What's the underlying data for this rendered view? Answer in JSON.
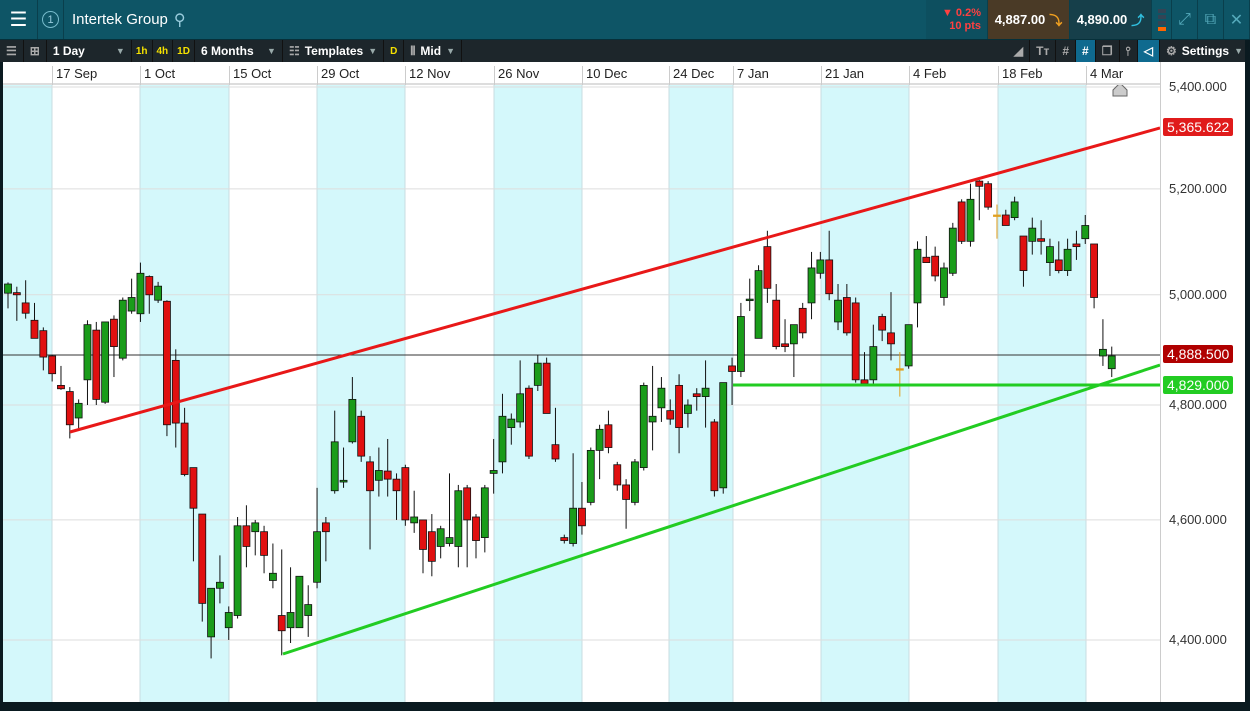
{
  "header": {
    "title": "Intertek Group",
    "badge": "1",
    "change_pct": "▼ 0.2%",
    "change_pts": "10 pts",
    "sell": "4,887.00",
    "buy": "4,890.00"
  },
  "toolbar": {
    "interval": "1 Day",
    "quick": [
      "1h",
      "4h",
      "1D"
    ],
    "range": "6 Months",
    "templates": "Templates",
    "d": "D",
    "price_type": "Mid",
    "settings": "Settings"
  },
  "dates": [
    "17 Sep",
    "1 Oct",
    "15 Oct",
    "29 Oct",
    "12 Nov",
    "26 Nov",
    "10 Dec",
    "24 Dec",
    "7 Jan",
    "21 Jan",
    "4 Feb",
    "18 Feb",
    "4 Mar"
  ],
  "price_axis": [
    "5,400.000",
    "5,200.000",
    "5,000.000",
    "4,800.000",
    "4,600.000",
    "4,400.000"
  ],
  "tags": {
    "upper_trend": "5,365.622",
    "current": "4,888.500",
    "support": "4,829.000"
  },
  "colors": {
    "up": "#1a9c1a",
    "down": "#e01010",
    "band": "#d4f8fb",
    "trend_up": "#e81818",
    "trend_low": "#22cc22"
  },
  "chart_data": {
    "type": "candlestick",
    "ylim": [
      4350,
      5420
    ],
    "ohlc": [
      [
        5003,
        5023,
        4975,
        5020
      ],
      [
        5004,
        5015,
        4952,
        5000
      ],
      [
        4985,
        5027,
        4956,
        4966
      ],
      [
        4953,
        4985,
        4920,
        4920
      ],
      [
        4934,
        4940,
        4862,
        4886
      ],
      [
        4888,
        4890,
        4842,
        4856
      ],
      [
        4835,
        4870,
        4827,
        4829
      ],
      [
        4824,
        4832,
        4741,
        4765
      ],
      [
        4777,
        4810,
        4755,
        4803
      ],
      [
        4845,
        4953,
        4800,
        4945
      ],
      [
        4935,
        4950,
        4800,
        4810
      ],
      [
        4805,
        4950,
        4802,
        4950
      ],
      [
        4955,
        4962,
        4850,
        4905
      ],
      [
        4884,
        4995,
        4880,
        4990
      ],
      [
        4970,
        5030,
        4965,
        4995
      ],
      [
        4965,
        5060,
        4950,
        5040
      ],
      [
        5034,
        5036,
        4965,
        5000
      ],
      [
        4990,
        5024,
        4985,
        5016
      ],
      [
        4988,
        4990,
        4745,
        4765
      ],
      [
        4880,
        4900,
        4725,
        4768
      ],
      [
        4768,
        4795,
        4675,
        4678
      ],
      [
        4690,
        4690,
        4530,
        4620
      ],
      [
        4610,
        4610,
        4430,
        4460
      ],
      [
        4405,
        4485,
        4370,
        4485
      ],
      [
        4485,
        4540,
        4460,
        4495
      ],
      [
        4420,
        4455,
        4400,
        4445
      ],
      [
        4440,
        4605,
        4435,
        4590
      ],
      [
        4590,
        4625,
        4520,
        4555
      ],
      [
        4580,
        4600,
        4540,
        4595
      ],
      [
        4580,
        4590,
        4510,
        4540
      ],
      [
        4498,
        4560,
        4485,
        4510
      ],
      [
        4440,
        4550,
        4375,
        4415
      ],
      [
        4420,
        4520,
        4395,
        4445
      ],
      [
        4420,
        4505,
        4420,
        4505
      ],
      [
        4440,
        4490,
        4405,
        4458
      ],
      [
        4495,
        4655,
        4485,
        4580
      ],
      [
        4595,
        4605,
        4530,
        4580
      ],
      [
        4650,
        4790,
        4645,
        4735
      ],
      [
        4665,
        4725,
        4655,
        4668
      ],
      [
        4735,
        4850,
        4732,
        4810
      ],
      [
        4780,
        4790,
        4700,
        4710
      ],
      [
        4700,
        4710,
        4550,
        4650
      ],
      [
        4668,
        4725,
        4640,
        4685
      ],
      [
        4684,
        4740,
        4640,
        4670
      ],
      [
        4670,
        4680,
        4600,
        4650
      ],
      [
        4690,
        4695,
        4590,
        4600
      ],
      [
        4595,
        4650,
        4578,
        4605
      ],
      [
        4600,
        4600,
        4510,
        4550
      ],
      [
        4580,
        4610,
        4505,
        4530
      ],
      [
        4555,
        4590,
        4535,
        4585
      ],
      [
        4560,
        4680,
        4555,
        4570
      ],
      [
        4555,
        4660,
        4520,
        4650
      ],
      [
        4655,
        4660,
        4520,
        4600
      ],
      [
        4605,
        4610,
        4535,
        4565
      ],
      [
        4570,
        4660,
        4545,
        4655
      ],
      [
        4680,
        4740,
        4645,
        4685
      ],
      [
        4700,
        4820,
        4680,
        4780
      ],
      [
        4760,
        4785,
        4730,
        4775
      ],
      [
        4770,
        4880,
        4760,
        4820
      ],
      [
        4830,
        4835,
        4705,
        4710
      ],
      [
        4835,
        4890,
        4825,
        4875
      ],
      [
        4875,
        4885,
        4785,
        4785
      ],
      [
        4730,
        4795,
        4700,
        4705
      ],
      [
        4570,
        4575,
        4560,
        4565
      ],
      [
        4560,
        4715,
        4555,
        4620
      ],
      [
        4620,
        4665,
        4575,
        4590
      ],
      [
        4630,
        4725,
        4625,
        4720
      ],
      [
        4720,
        4765,
        4670,
        4757
      ],
      [
        4765,
        4790,
        4715,
        4725
      ],
      [
        4695,
        4700,
        4650,
        4660
      ],
      [
        4660,
        4670,
        4585,
        4635
      ],
      [
        4630,
        4705,
        4625,
        4700
      ],
      [
        4690,
        4840,
        4685,
        4835
      ],
      [
        4770,
        4870,
        4720,
        4780
      ],
      [
        4795,
        4850,
        4770,
        4830
      ],
      [
        4790,
        4810,
        4765,
        4775
      ],
      [
        4835,
        4855,
        4715,
        4760
      ],
      [
        4785,
        4810,
        4760,
        4800
      ],
      [
        4820,
        4830,
        4790,
        4815
      ],
      [
        4815,
        4880,
        4760,
        4830
      ],
      [
        4770,
        4775,
        4640,
        4650
      ],
      [
        4655,
        4840,
        4645,
        4840
      ],
      [
        4870,
        4885,
        4800,
        4860
      ],
      [
        4860,
        4985,
        4850,
        4960
      ],
      [
        4990,
        5030,
        4970,
        4992
      ],
      [
        4920,
        5055,
        4920,
        5045
      ],
      [
        5090,
        5120,
        4985,
        5012
      ],
      [
        4990,
        5020,
        4900,
        4905
      ],
      [
        4910,
        4955,
        4895,
        4905
      ],
      [
        4910,
        4940,
        4850,
        4945
      ],
      [
        4975,
        4985,
        4920,
        4930
      ],
      [
        4985,
        5080,
        4955,
        5050
      ],
      [
        5040,
        5080,
        5030,
        5065
      ],
      [
        5065,
        5120,
        4990,
        5002
      ],
      [
        4950,
        5020,
        4935,
        4990
      ],
      [
        4995,
        5020,
        4925,
        4930
      ],
      [
        4985,
        4995,
        4840,
        4845
      ],
      [
        4845,
        4895,
        4835,
        4838
      ],
      [
        4845,
        4945,
        4835,
        4905
      ],
      [
        4960,
        4965,
        4915,
        4935
      ],
      [
        4930,
        5005,
        4880,
        4910
      ],
      [
        4865,
        4895,
        4815,
        4865
      ],
      [
        4870,
        4940,
        4865,
        4945
      ],
      [
        4985,
        5100,
        4940,
        5085
      ],
      [
        5070,
        5110,
        5060,
        5060
      ],
      [
        5072,
        5090,
        5025,
        5035
      ],
      [
        4995,
        5060,
        4980,
        5050
      ],
      [
        5040,
        5135,
        5035,
        5125
      ],
      [
        5175,
        5180,
        5095,
        5100
      ],
      [
        5100,
        5210,
        5090,
        5180
      ],
      [
        5215,
        5217,
        5140,
        5205
      ],
      [
        5210,
        5215,
        5160,
        5165
      ],
      [
        5150,
        5170,
        5105,
        5150
      ],
      [
        5150,
        5160,
        5130,
        5130
      ],
      [
        5145,
        5185,
        5140,
        5175
      ],
      [
        5110,
        5110,
        5015,
        5045
      ],
      [
        5100,
        5145,
        5075,
        5125
      ],
      [
        5105,
        5140,
        5075,
        5100
      ],
      [
        5060,
        5105,
        5035,
        5090
      ],
      [
        5065,
        5100,
        5040,
        5045
      ],
      [
        5045,
        5105,
        5035,
        5085
      ],
      [
        5095,
        5120,
        5065,
        5090
      ],
      [
        5105,
        5150,
        5095,
        5130
      ],
      [
        5095,
        5095,
        4975,
        4995
      ],
      [
        4888,
        4955,
        4870,
        4900
      ],
      [
        4865,
        4905,
        4850,
        4888
      ]
    ]
  }
}
